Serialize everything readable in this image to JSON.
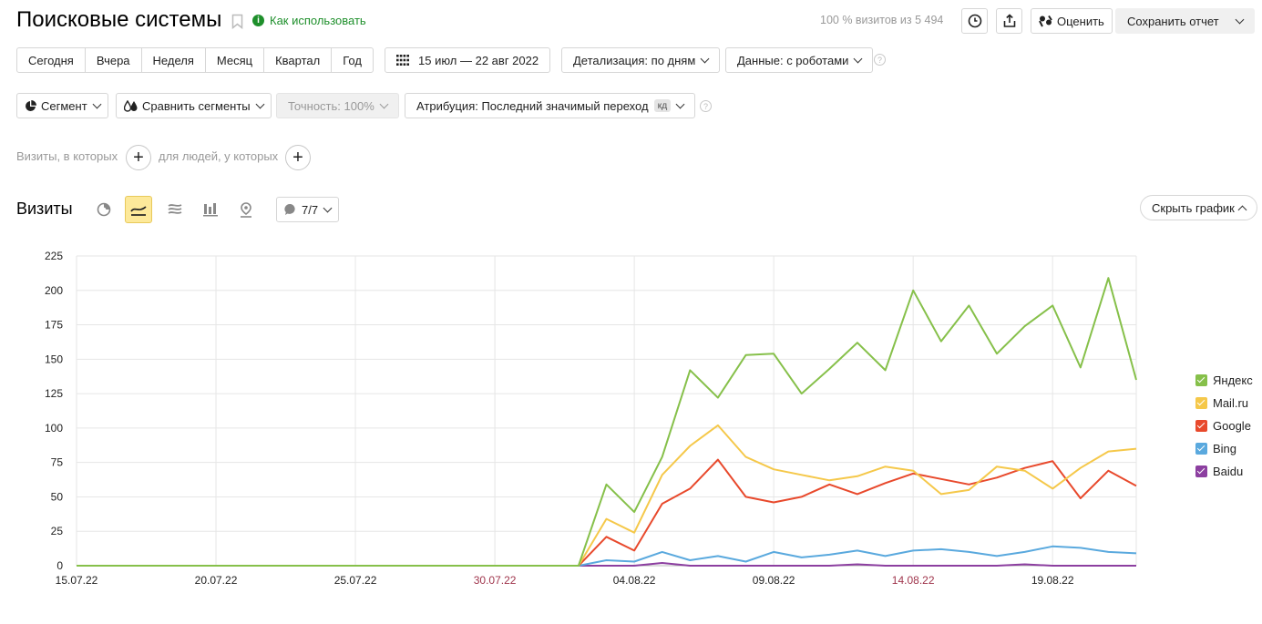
{
  "header": {
    "title": "Поисковые системы",
    "how_to_use": "Как использовать",
    "visits_summary": "100 % визитов из 5 494",
    "rate_label": "Оценить",
    "save_report_label": "Сохранить отчет"
  },
  "periods": [
    "Сегодня",
    "Вчера",
    "Неделя",
    "Месяц",
    "Квартал",
    "Год"
  ],
  "date_range": "15 июл — 22 авг 2022",
  "detail_label": "Детализация: по дням",
  "data_label": "Данные: с роботами",
  "segment_label": "Сегмент",
  "compare_segments_label": "Сравнить сегменты",
  "accuracy_label": "Точность: 100%",
  "attribution_label": "Атрибуция: Последний значимый переход",
  "attribution_badge": "кд",
  "filters": {
    "visits_where": "Визиты, в которых",
    "for_people": "для людей, у которых"
  },
  "chart_section": {
    "title": "Визиты",
    "series_count": "7/7",
    "hide_chart_label": "Скрыть график"
  },
  "colors": {
    "yandex": "#86c04a",
    "mailru": "#f5c84a",
    "google": "#e8492c",
    "bing": "#5aa9de",
    "baidu": "#8c3fa0",
    "weekend_tick": "#a0364d",
    "accent_green": "#1e8f2b"
  },
  "chart_data": {
    "type": "line",
    "x": [
      "15.07.22",
      "16.07.22",
      "17.07.22",
      "18.07.22",
      "19.07.22",
      "20.07.22",
      "21.07.22",
      "22.07.22",
      "23.07.22",
      "24.07.22",
      "25.07.22",
      "26.07.22",
      "27.07.22",
      "28.07.22",
      "29.07.22",
      "30.07.22",
      "31.07.22",
      "01.08.22",
      "02.08.22",
      "03.08.22",
      "04.08.22",
      "05.08.22",
      "06.08.22",
      "07.08.22",
      "08.08.22",
      "09.08.22",
      "10.08.22",
      "11.08.22",
      "12.08.22",
      "13.08.22",
      "14.08.22",
      "15.08.22",
      "16.08.22",
      "17.08.22",
      "18.08.22",
      "19.08.22",
      "20.08.22",
      "21.08.22",
      "22.08.22"
    ],
    "x_ticks": [
      {
        "label": "15.07.22",
        "index": 0,
        "weekend": false
      },
      {
        "label": "20.07.22",
        "index": 5,
        "weekend": false
      },
      {
        "label": "25.07.22",
        "index": 10,
        "weekend": false
      },
      {
        "label": "30.07.22",
        "index": 15,
        "weekend": true
      },
      {
        "label": "04.08.22",
        "index": 20,
        "weekend": false
      },
      {
        "label": "09.08.22",
        "index": 25,
        "weekend": false
      },
      {
        "label": "14.08.22",
        "index": 30,
        "weekend": true
      },
      {
        "label": "19.08.22",
        "index": 35,
        "weekend": false
      }
    ],
    "ylim": [
      0,
      225
    ],
    "yticks": [
      0,
      25,
      50,
      75,
      100,
      125,
      150,
      175,
      200,
      225
    ],
    "grid": true,
    "legend_position": "right",
    "series": [
      {
        "name": "Яндекс",
        "color": "#86c04a",
        "values": [
          0,
          0,
          0,
          0,
          0,
          0,
          0,
          0,
          0,
          0,
          0,
          0,
          0,
          0,
          0,
          0,
          0,
          0,
          0,
          59,
          39,
          79,
          142,
          122,
          153,
          154,
          125,
          143,
          162,
          142,
          200,
          163,
          189,
          154,
          174,
          189,
          144,
          209,
          135
        ]
      },
      {
        "name": "Mail.ru",
        "color": "#f5c84a",
        "values": [
          0,
          0,
          0,
          0,
          0,
          0,
          0,
          0,
          0,
          0,
          0,
          0,
          0,
          0,
          0,
          0,
          0,
          0,
          0,
          34,
          24,
          66,
          87,
          102,
          79,
          70,
          66,
          62,
          65,
          72,
          69,
          52,
          55,
          72,
          69,
          56,
          71,
          83,
          85
        ]
      },
      {
        "name": "Google",
        "color": "#e8492c",
        "values": [
          0,
          0,
          0,
          0,
          0,
          0,
          0,
          0,
          0,
          0,
          0,
          0,
          0,
          0,
          0,
          0,
          0,
          0,
          0,
          21,
          11,
          45,
          56,
          77,
          50,
          46,
          50,
          59,
          52,
          60,
          67,
          63,
          59,
          64,
          71,
          76,
          49,
          69,
          58
        ]
      },
      {
        "name": "Bing",
        "color": "#5aa9de",
        "values": [
          0,
          0,
          0,
          0,
          0,
          0,
          0,
          0,
          0,
          0,
          0,
          0,
          0,
          0,
          0,
          0,
          0,
          0,
          0,
          4,
          3,
          10,
          4,
          7,
          3,
          10,
          6,
          8,
          11,
          7,
          11,
          12,
          10,
          7,
          10,
          14,
          13,
          10,
          9
        ]
      },
      {
        "name": "Baidu",
        "color": "#8c3fa0",
        "values": [
          0,
          0,
          0,
          0,
          0,
          0,
          0,
          0,
          0,
          0,
          0,
          0,
          0,
          0,
          0,
          0,
          0,
          0,
          0,
          0,
          0,
          2,
          0,
          0,
          0,
          0,
          0,
          0,
          1,
          0,
          0,
          0,
          0,
          0,
          1,
          0,
          0,
          0,
          0
        ]
      }
    ]
  }
}
